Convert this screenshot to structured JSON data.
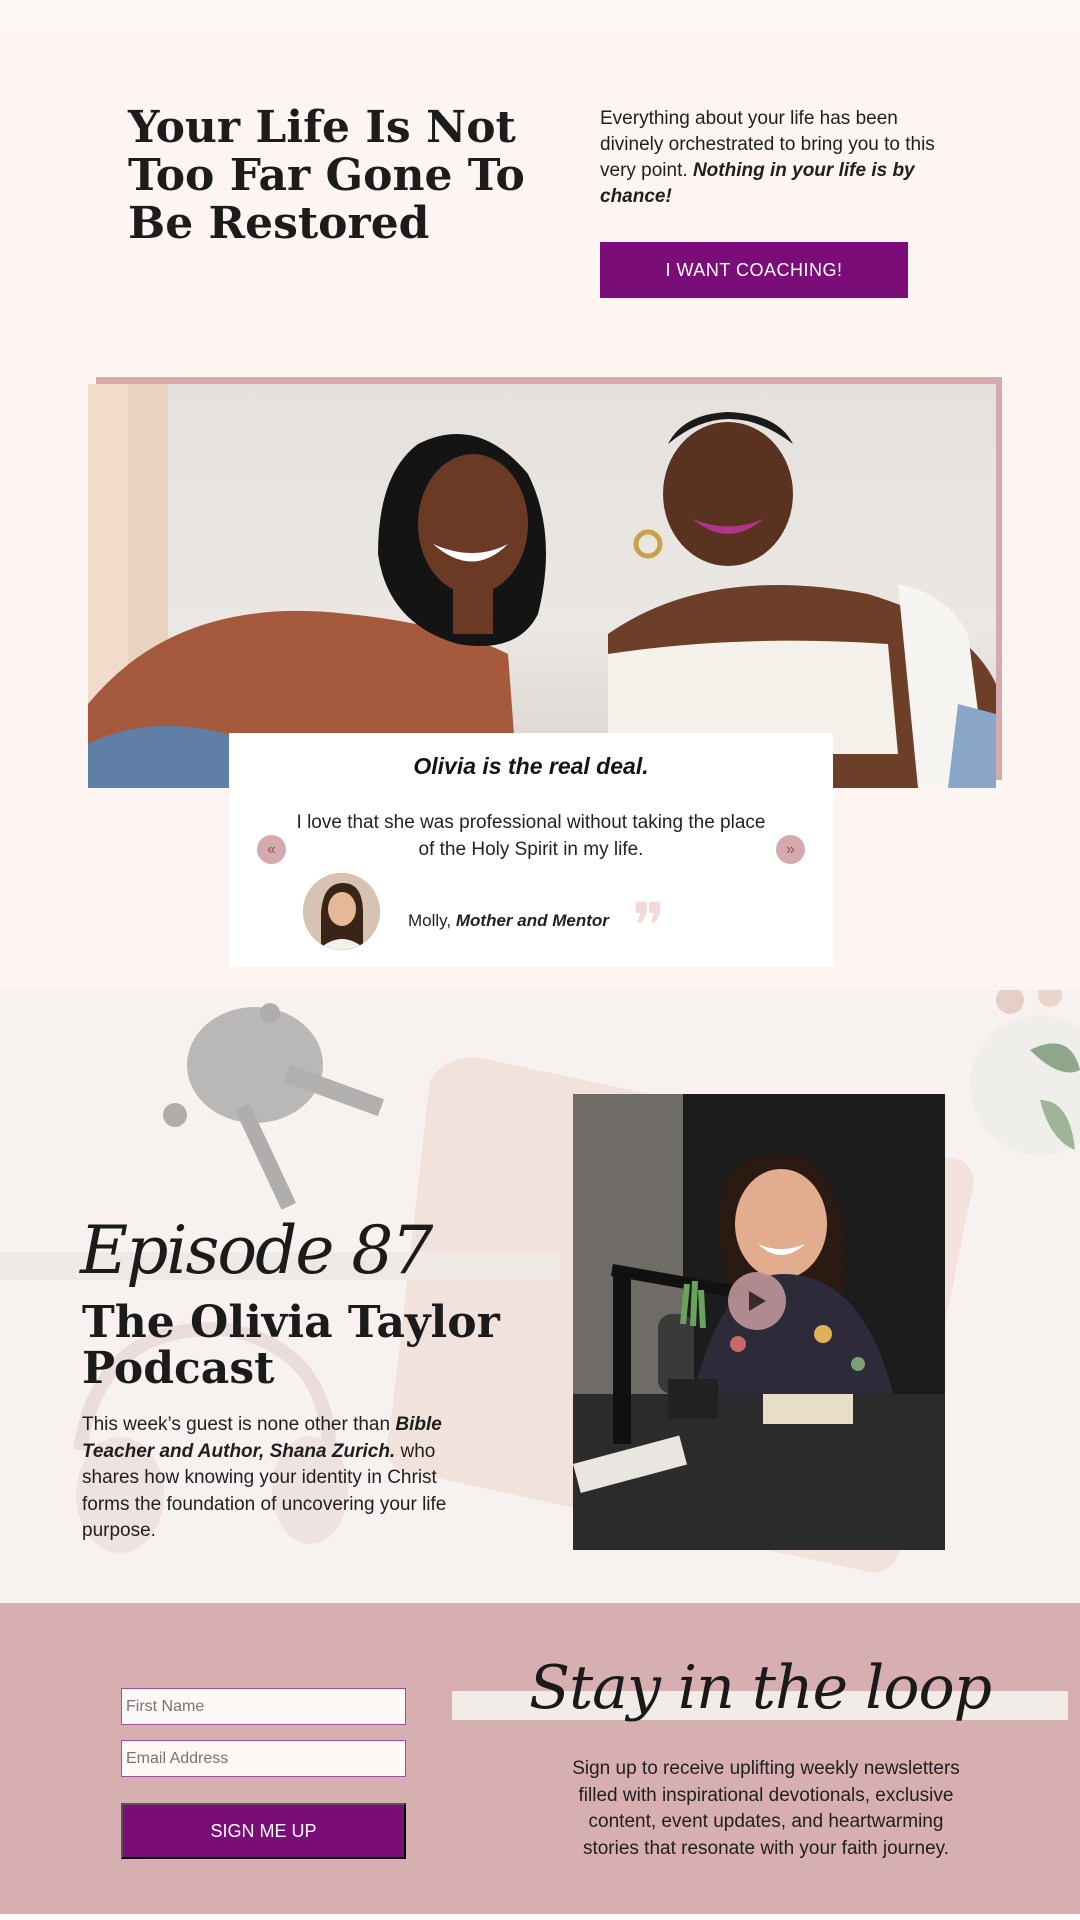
{
  "hero": {
    "title": "Your Life Is Not Too Far Gone To Be Restored",
    "intro": "Everything about your life has been divinely orchestrated to bring you to this very point.",
    "intro_emphasis": "Nothing in your life is by chance!",
    "cta_label": "I WANT COACHING!"
  },
  "testimonial": {
    "headline": "Olivia is the real deal.",
    "quote": "I love that she was professional without taking the place of the Holy Spirit in my life.",
    "author_name": "Molly,",
    "author_role": "Mother and Mentor",
    "prev_icon": "«",
    "next_icon": "»",
    "quote_icon": "❞"
  },
  "podcast": {
    "episode": "Episode 87",
    "title": "The Olivia Taylor Podcast",
    "desc_intro": "This week’s guest is none other than",
    "guest": "Bible Teacher and Author, Shana Zurich.",
    "desc_rest": "who shares how knowing your identity in Christ forms the foundation of uncovering your life purpose."
  },
  "signup": {
    "first_name_placeholder": "First Name",
    "email_placeholder": "Email Address",
    "submit_label": "SIGN ME UP",
    "heading": "Stay in the loop",
    "text": "Sign up to receive uplifting weekly newsletters filled with inspirational devotionals, exclusive content, event updates, and heartwarming stories that resonate with your faith journey."
  },
  "colors": {
    "accent_purple": "#7b0d78",
    "rose": "#d8afb1",
    "cream": "#fcf5f2"
  }
}
